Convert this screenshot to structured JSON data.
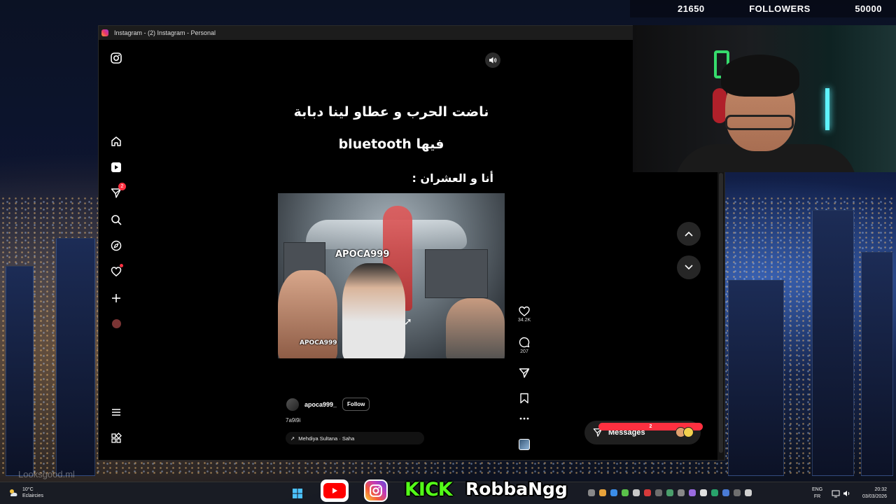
{
  "overlay": {
    "current_count": "21650",
    "label": "FOLLOWERS",
    "goal": "50000"
  },
  "window": {
    "title": "Instagram - (2) Instagram - Personal",
    "icon": "instagram-app-icon"
  },
  "sidebar": {
    "items": [
      {
        "name": "instagram-logo-icon"
      },
      {
        "name": "home-icon"
      },
      {
        "name": "reels-icon"
      },
      {
        "name": "messages-icon",
        "badge": "2"
      },
      {
        "name": "search-icon"
      },
      {
        "name": "explore-icon"
      },
      {
        "name": "notifications-icon"
      },
      {
        "name": "create-icon"
      },
      {
        "name": "profile-avatar"
      },
      {
        "name": "menu-icon"
      },
      {
        "name": "more-apps-icon"
      }
    ]
  },
  "reel": {
    "caption_line1": "ناضت الحرب و عطاو لينا دبابة",
    "caption_line2": "فيها bluetooth",
    "caption_line3": "أنا و العشران :",
    "video_label_top": "APOCA999",
    "video_label_bottom": "APOCA999",
    "author": "apoca999_",
    "follow_label": "Follow",
    "post_caption": "7a9i9i",
    "audio": "Mehdiya Sultana · Saha",
    "likes": "34.2K",
    "comments": "207"
  },
  "messages": {
    "label": "Messages",
    "badge": "2"
  },
  "taskbar": {
    "temperature": "10°C",
    "condition": "Eclaircies",
    "lang_top": "ENG",
    "lang_bottom": "FR",
    "time": "20:32",
    "date": "03/03/2026"
  },
  "stream": {
    "kick_label": "KICK",
    "handle": "RobbaNgg",
    "watermark": "Looksgood.ml"
  },
  "colors": {
    "accent_red": "#ff3040",
    "kick_green": "#53fc18",
    "youtube_red": "#ff0000"
  }
}
